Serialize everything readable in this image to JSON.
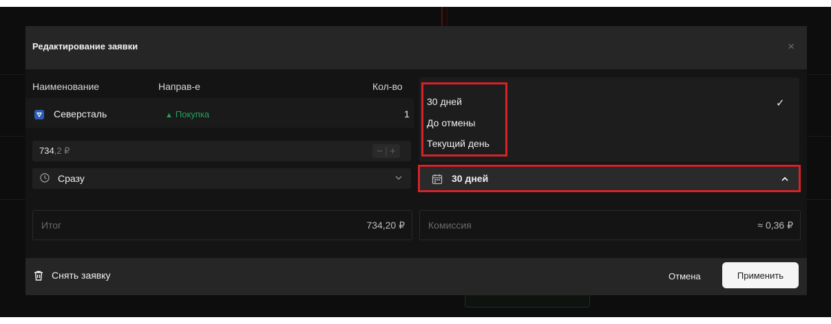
{
  "dialog": {
    "title": "Редактирование заявки",
    "close_icon": "×"
  },
  "table": {
    "headers": {
      "name": "Наименование",
      "direction": "Направ-е",
      "quantity": "Кол-во"
    },
    "row": {
      "name": "Северсталь",
      "direction_icon": "▲",
      "direction": "Покупка",
      "direction_color": "#25a35a",
      "quantity": "1"
    }
  },
  "price": {
    "value": "734",
    "decimal": ",2 ₽",
    "minus": "−",
    "plus": "+"
  },
  "execution": {
    "value": "Сразу"
  },
  "validity": {
    "options": [
      "30 дней",
      "До отмены",
      "Текущий день"
    ],
    "selected_check": "✓",
    "value": "30 дней"
  },
  "totals": {
    "total_label": "Итог",
    "total_value": "734,20 ₽",
    "commission_label": "Комиссия",
    "commission_value": "≈ 0,36 ₽"
  },
  "footer": {
    "cancel_order": "Снять заявку",
    "cancel": "Отмена",
    "apply": "Применить"
  },
  "colors": {
    "highlight": "#d92128",
    "accent_green": "#25a35a"
  }
}
